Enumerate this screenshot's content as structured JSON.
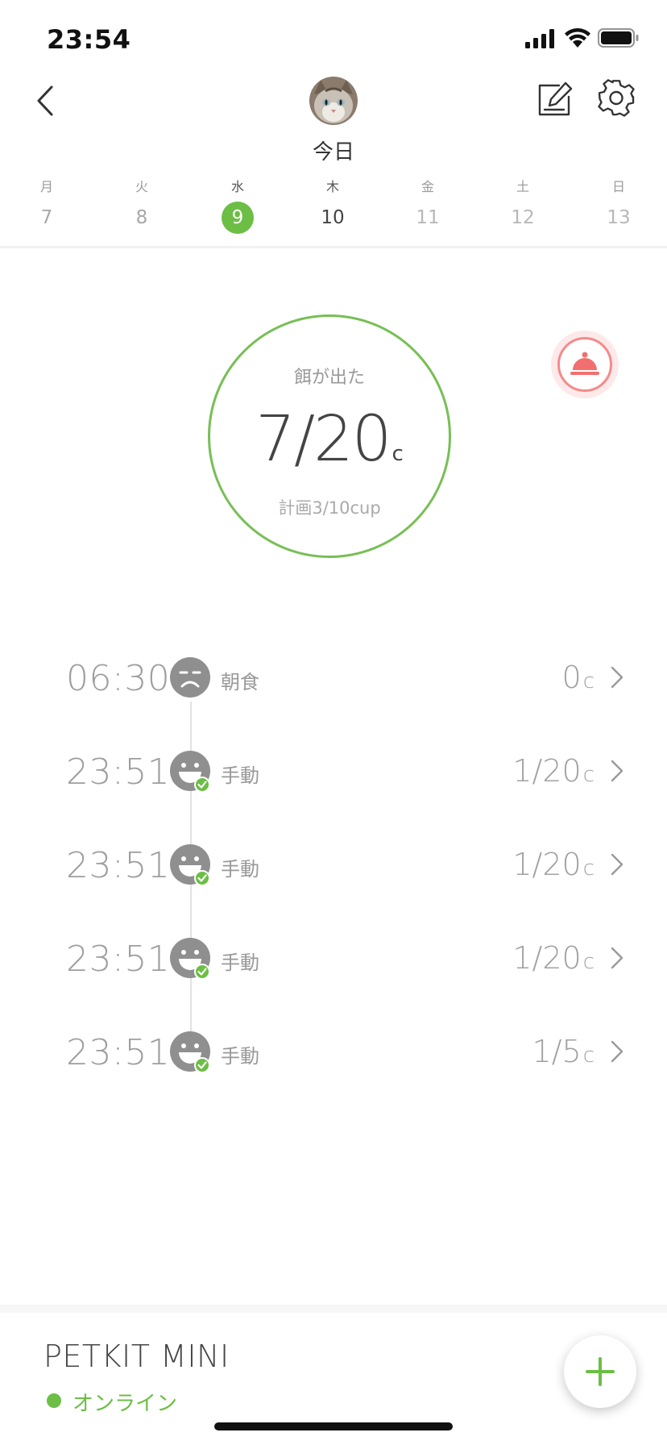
{
  "status_bar": {
    "time": "23:54",
    "icons": [
      "signal-icon",
      "wifi-icon",
      "battery-icon"
    ]
  },
  "header": {
    "title": "今日",
    "avatar": "cat-avatar",
    "icons": [
      "back-icon",
      "edit-icon",
      "gear-icon"
    ]
  },
  "week": [
    {
      "weekday": "月",
      "day": "7"
    },
    {
      "weekday": "火",
      "day": "8"
    },
    {
      "weekday": "水",
      "day": "9",
      "selected": true
    },
    {
      "weekday": "木",
      "day": "10"
    },
    {
      "weekday": "金",
      "day": "11"
    },
    {
      "weekday": "土",
      "day": "12"
    },
    {
      "weekday": "日",
      "day": "13"
    }
  ],
  "summary": {
    "label": "餌が出た",
    "value": "7/20",
    "unit": "c",
    "plan": "計画3/10cup"
  },
  "feed_button_icon": "bell-icon",
  "timeline": [
    {
      "time": "06:30",
      "name": "朝食",
      "amount": "0",
      "unit": "c",
      "status": "sad-face-icon"
    },
    {
      "time": "23:51",
      "name": "手動",
      "amount": "1/20",
      "unit": "c",
      "status": "happy-face-icon"
    },
    {
      "time": "23:51",
      "name": "手動",
      "amount": "1/20",
      "unit": "c",
      "status": "happy-face-icon"
    },
    {
      "time": "23:51",
      "name": "手動",
      "amount": "1/20",
      "unit": "c",
      "status": "happy-face-icon"
    },
    {
      "time": "23:51",
      "name": "手動",
      "amount": "1/5",
      "unit": "c",
      "status": "happy-face-icon"
    }
  ],
  "device": {
    "name": "PETKIT MINI",
    "status": "オンライン"
  },
  "colors": {
    "accent": "#6cbe45",
    "ring": "#77bf55",
    "alert": "#f48b8b",
    "muted": "#9e9e9e"
  }
}
